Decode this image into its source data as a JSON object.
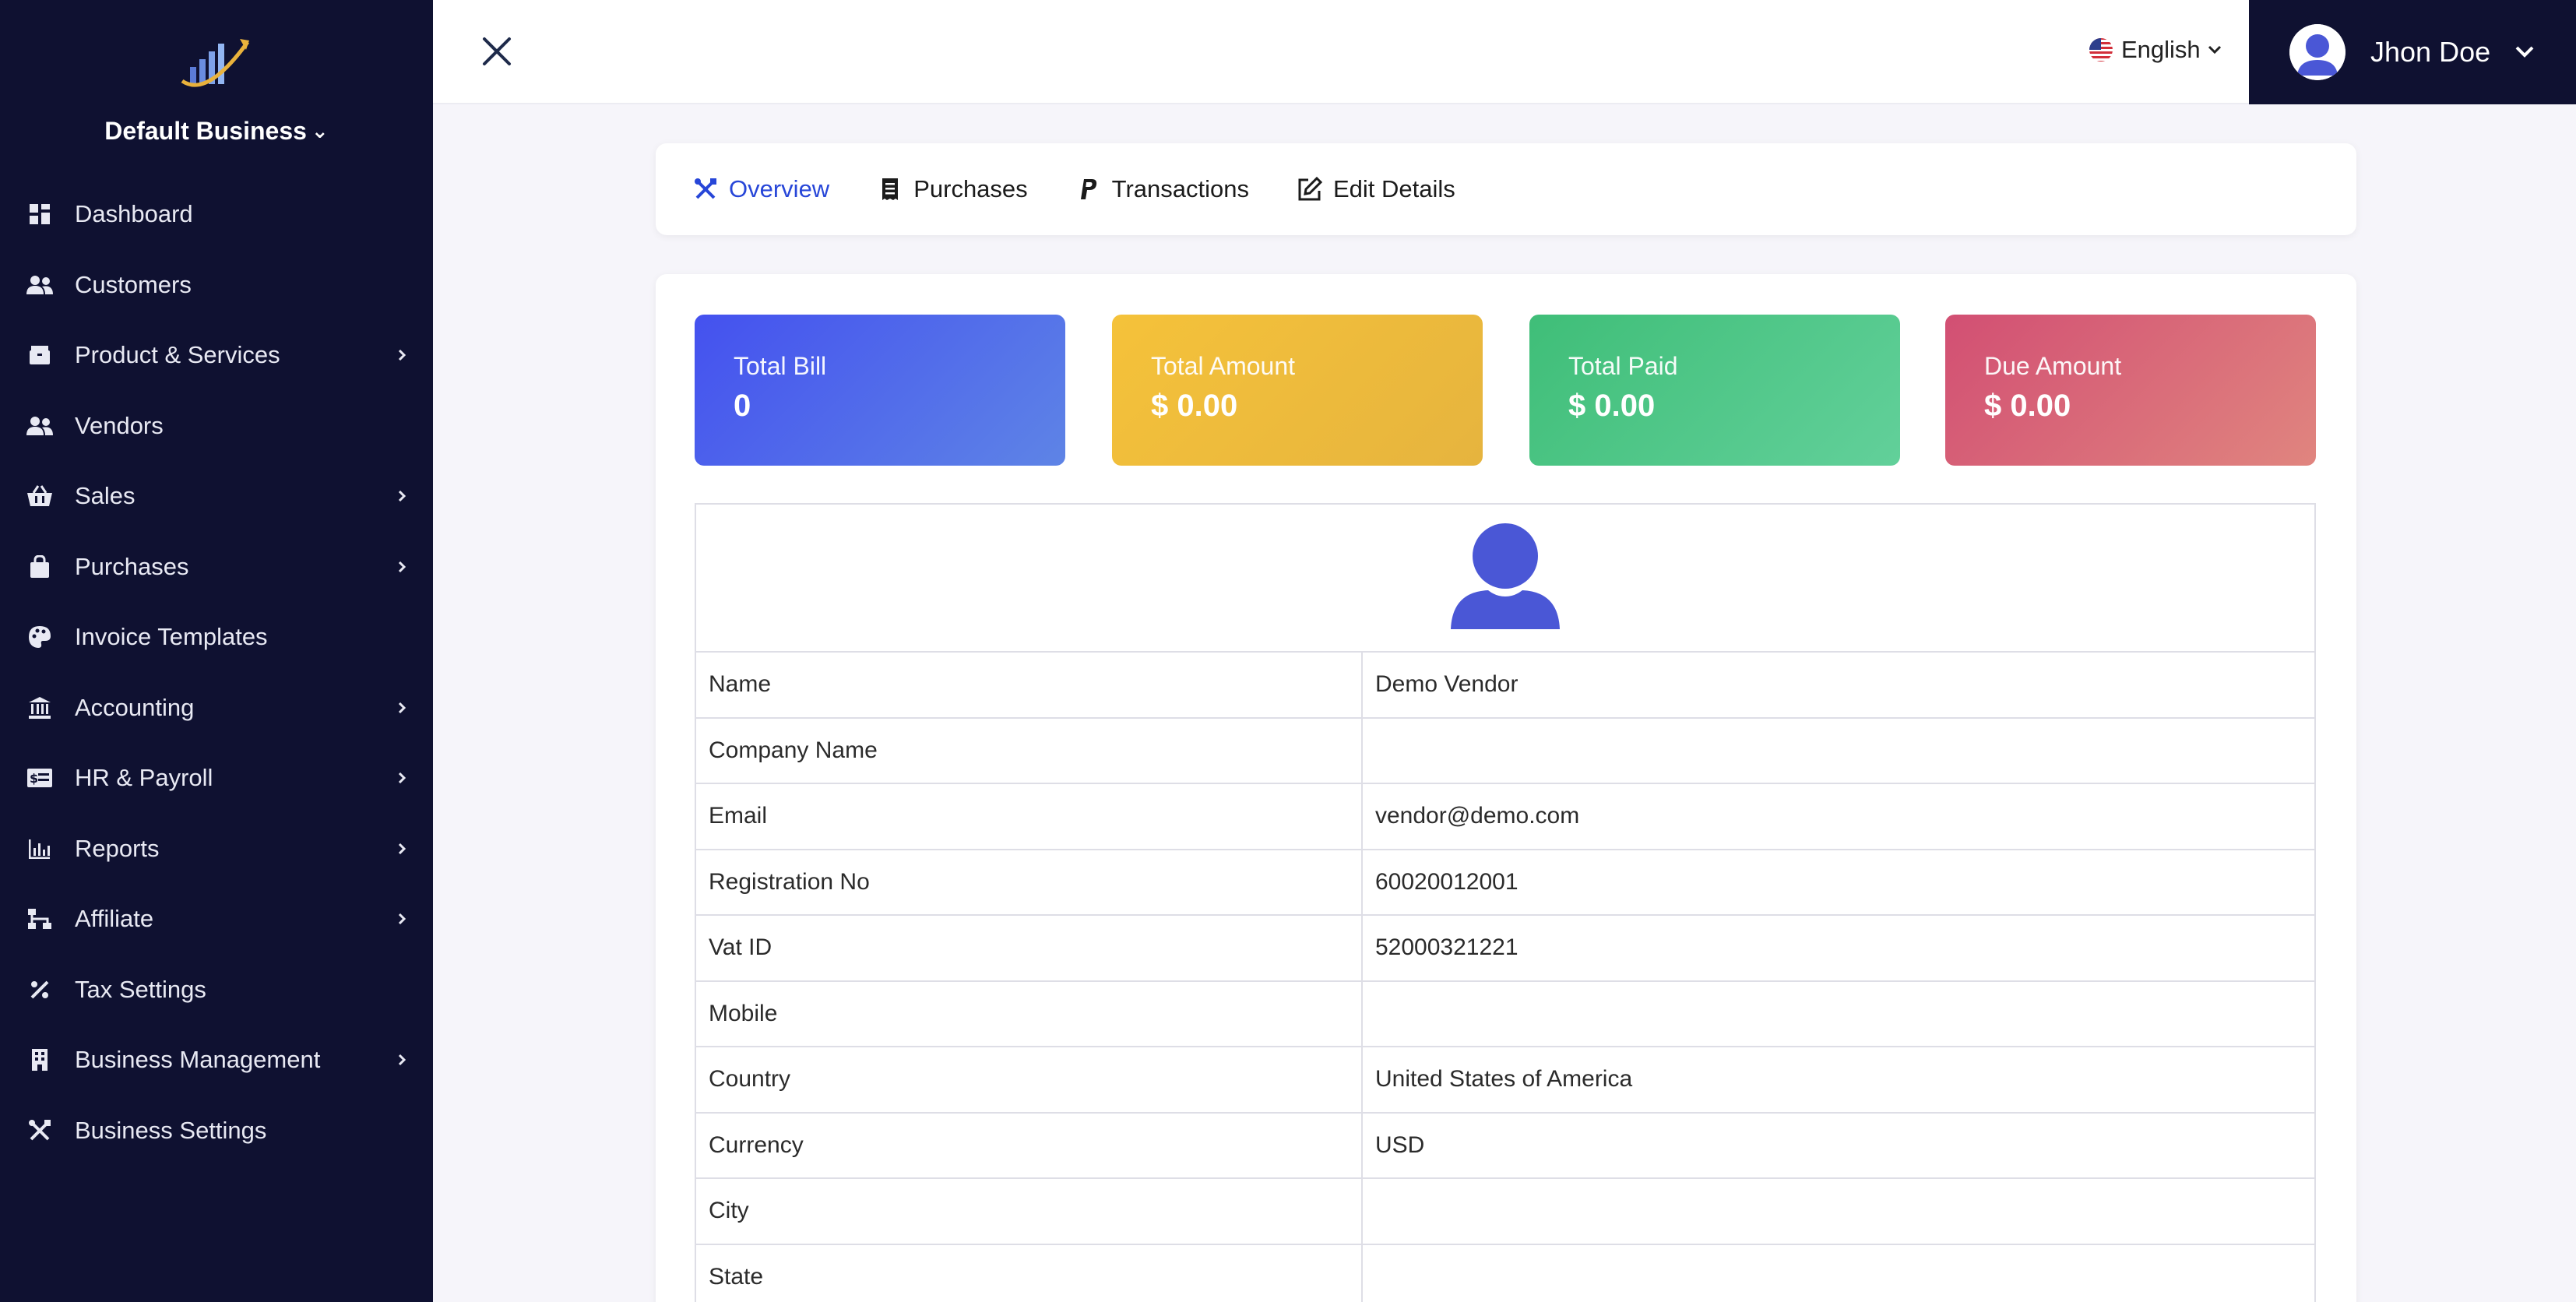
{
  "sidebar": {
    "business_name": "Default Business",
    "items": [
      {
        "label": "Dashboard",
        "icon": "dashboard-icon",
        "has_submenu": false
      },
      {
        "label": "Customers",
        "icon": "users-icon",
        "has_submenu": false
      },
      {
        "label": "Product & Services",
        "icon": "box-icon",
        "has_submenu": true
      },
      {
        "label": "Vendors",
        "icon": "users-icon",
        "has_submenu": false
      },
      {
        "label": "Sales",
        "icon": "basket-icon",
        "has_submenu": true
      },
      {
        "label": "Purchases",
        "icon": "bag-icon",
        "has_submenu": true
      },
      {
        "label": "Invoice Templates",
        "icon": "palette-icon",
        "has_submenu": false
      },
      {
        "label": "Accounting",
        "icon": "bank-icon",
        "has_submenu": true
      },
      {
        "label": "HR & Payroll",
        "icon": "id-card-icon",
        "has_submenu": true
      },
      {
        "label": "Reports",
        "icon": "chart-icon",
        "has_submenu": true
      },
      {
        "label": "Affiliate",
        "icon": "sitemap-icon",
        "has_submenu": true
      },
      {
        "label": "Tax Settings",
        "icon": "percent-icon",
        "has_submenu": false
      },
      {
        "label": "Business Management",
        "icon": "building-icon",
        "has_submenu": true
      },
      {
        "label": "Business Settings",
        "icon": "tools-icon",
        "has_submenu": false
      }
    ]
  },
  "topbar": {
    "language": "English",
    "user_name": "Jhon Doe"
  },
  "tabs": [
    {
      "label": "Overview",
      "active": true
    },
    {
      "label": "Purchases",
      "active": false
    },
    {
      "label": "Transactions",
      "active": false
    },
    {
      "label": "Edit Details",
      "active": false
    }
  ],
  "stats": [
    {
      "label": "Total Bill",
      "value": "0"
    },
    {
      "label": "Total Amount",
      "value": "$ 0.00"
    },
    {
      "label": "Total Paid",
      "value": "$ 0.00"
    },
    {
      "label": "Due Amount",
      "value": "$ 0.00"
    }
  ],
  "details": [
    {
      "label": "Name",
      "value": "Demo Vendor"
    },
    {
      "label": "Company Name",
      "value": ""
    },
    {
      "label": "Email",
      "value": "vendor@demo.com"
    },
    {
      "label": "Registration No",
      "value": "60020012001"
    },
    {
      "label": "Vat ID",
      "value": "52000321221"
    },
    {
      "label": "Mobile",
      "value": ""
    },
    {
      "label": "Country",
      "value": "United States of America"
    },
    {
      "label": "Currency",
      "value": "USD"
    },
    {
      "label": "City",
      "value": ""
    },
    {
      "label": "State",
      "value": ""
    }
  ],
  "colors": {
    "sidebar_bg": "#0f1131",
    "accent": "#2746d8",
    "stat_blue": "#4451ef",
    "stat_yellow": "#f5c23a",
    "stat_green": "#3fbe78",
    "stat_red": "#d24f73"
  }
}
